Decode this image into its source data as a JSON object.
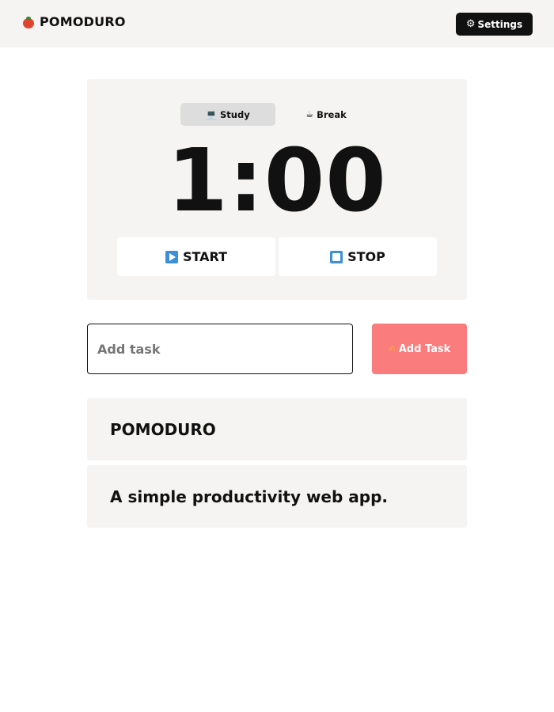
{
  "header": {
    "app_name": "POMODURO",
    "settings_label": "Settings",
    "brand_icon": "tomato-icon",
    "settings_icon": "gear-icon"
  },
  "timer": {
    "modes": [
      {
        "label": "Study",
        "icon": "laptop-icon",
        "active": true
      },
      {
        "label": "Break",
        "icon": "coffee-icon",
        "active": false
      }
    ],
    "display": "1:00",
    "start_label": "START",
    "stop_label": "STOP"
  },
  "task": {
    "placeholder": "Add task",
    "value": "",
    "add_label": "Add Task",
    "add_icon": "writing-hand-icon"
  },
  "info": {
    "title": "POMODURO",
    "description": "A simple productivity web app."
  },
  "colors": {
    "accent": "#fa7c7c",
    "panel": "#f5f4f2",
    "dark_button": "#111111",
    "icon_blue": "#3d8fd8"
  }
}
